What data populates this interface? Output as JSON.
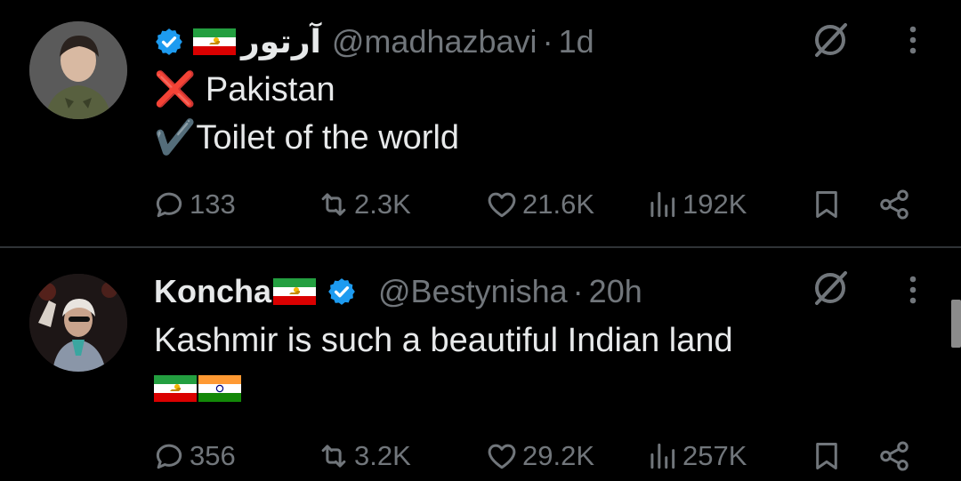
{
  "tweets": [
    {
      "display_name": "آرتور",
      "handle": "@madhazbavi",
      "separator": "·",
      "time": "1d",
      "lines": [
        "❌ Pakistan",
        "✔️Toilet of the world"
      ],
      "stats": {
        "replies": "133",
        "reposts": "2.3K",
        "likes": "21.6K",
        "views": "192K"
      },
      "flags": [
        "iran-lion-sun-flag"
      ],
      "verified": true
    },
    {
      "display_name": "Koncha",
      "handle": "@Bestynisha",
      "separator": "·",
      "time": "20h",
      "lines": [
        "Kashmir is such a beautiful Indian land"
      ],
      "stats": {
        "replies": "356",
        "reposts": "3.2K",
        "likes": "29.2K",
        "views": "257K"
      },
      "flags": [
        "iran-lion-sun-flag",
        "india-flag"
      ],
      "verified": true
    }
  ],
  "colors": {
    "background": "#000000",
    "text": "#e7e9ea",
    "muted": "#71767b",
    "verified_blue": "#1d9bf0",
    "divider": "#2f3336"
  },
  "icons": {
    "reply": "speech-bubble-icon",
    "repost": "retweet-icon",
    "like": "heart-icon",
    "views": "bar-chart-icon",
    "bookmark": "bookmark-icon",
    "share": "share-icon",
    "grok": "grok-icon",
    "more": "more-vertical-icon"
  }
}
